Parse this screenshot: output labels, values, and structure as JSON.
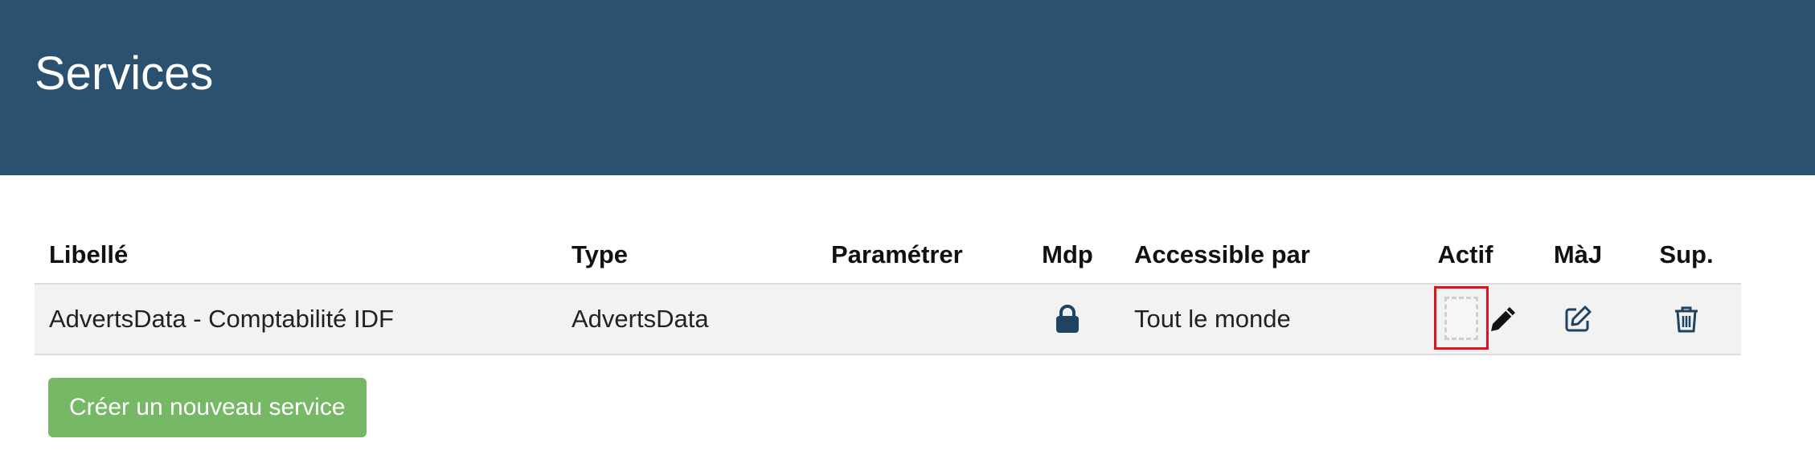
{
  "header": {
    "title": "Services"
  },
  "table": {
    "columns": {
      "libelle": "Libellé",
      "type": "Type",
      "parametrer": "Paramétrer",
      "mdp": "Mdp",
      "accessible": "Accessible par",
      "actif": "Actif",
      "maj": "MàJ",
      "sup": "Sup."
    },
    "rows": [
      {
        "libelle": "AdvertsData - Comptabilité IDF",
        "type": "AdvertsData",
        "parametrer": "",
        "mdp_icon": "lock-icon",
        "accessible": "Tout le monde",
        "actif_icon": "empty-toggle",
        "maj_icon": "edit-icon",
        "sup_icon": "trash-icon"
      }
    ]
  },
  "actions": {
    "create_label": "Créer un nouveau service"
  },
  "colors": {
    "header_bg": "#2a516f",
    "create_button": "#76b865",
    "icon": "#1f4461",
    "highlight": "#e0131a"
  }
}
